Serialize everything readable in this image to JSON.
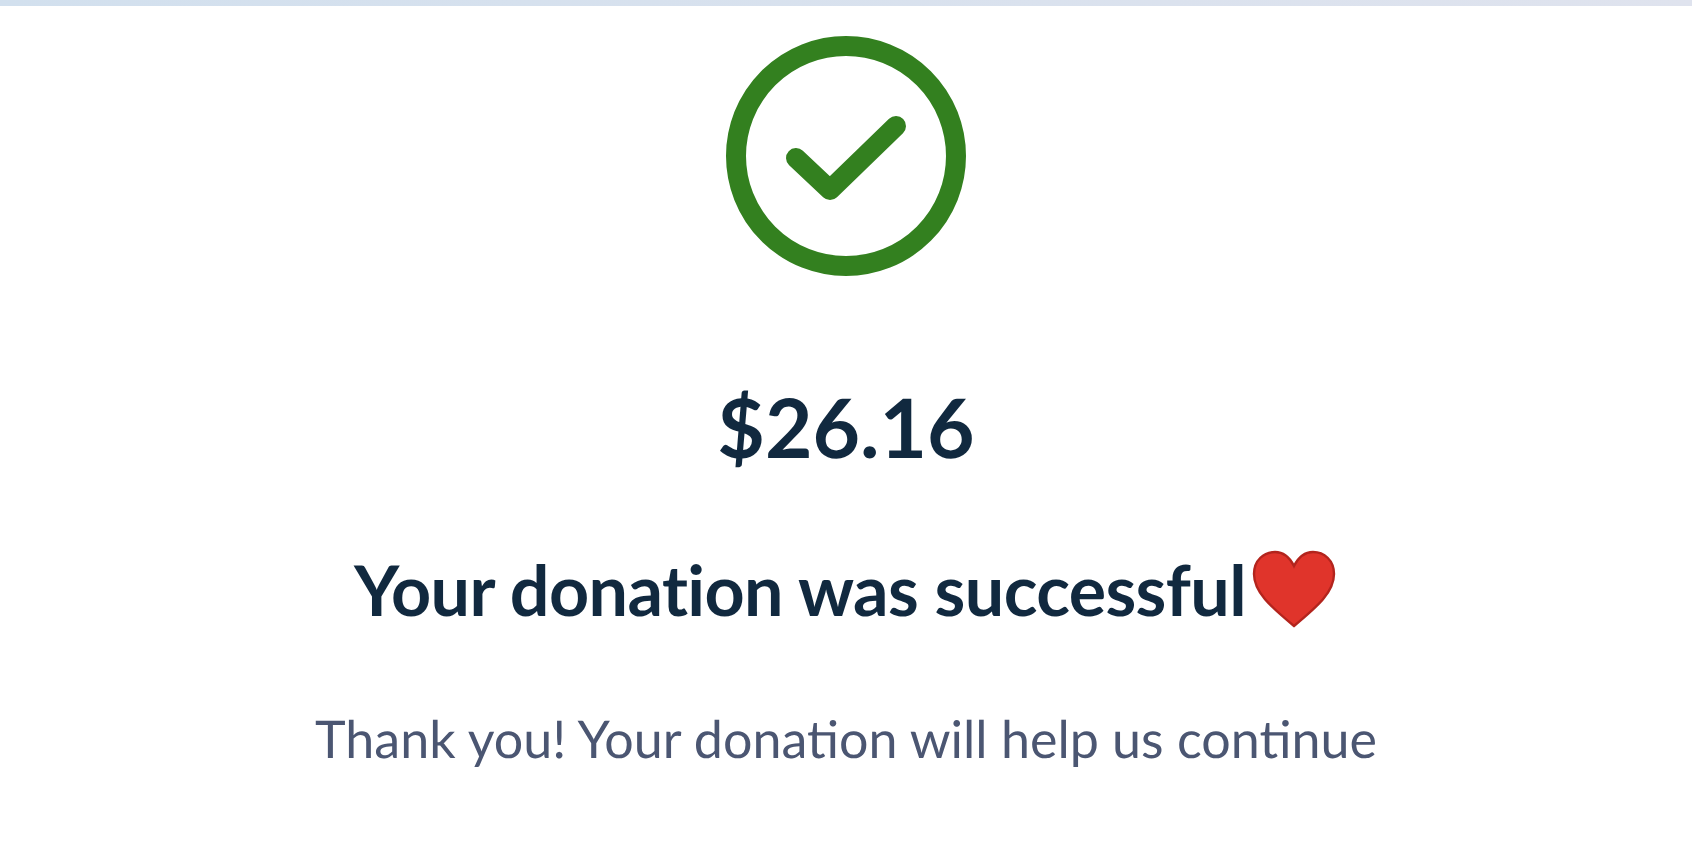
{
  "amount": "$26.16",
  "title": "Your donation was successful",
  "message": "Thank you! Your donation will help us continue"
}
